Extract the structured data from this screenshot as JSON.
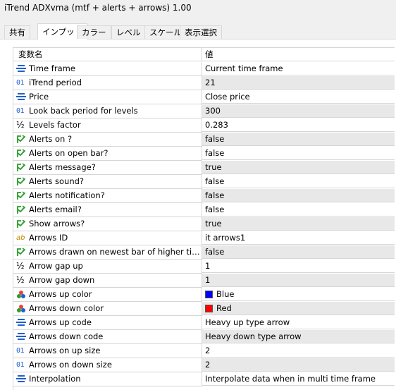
{
  "window": {
    "title": "iTrend ADXvma (mtf + alerts + arrows) 1.00"
  },
  "tabs": [
    {
      "label": "共有"
    },
    {
      "label": "インプット"
    },
    {
      "label": "カラー"
    },
    {
      "label": "レベル"
    },
    {
      "label": "スケール"
    },
    {
      "label": "表示選択"
    }
  ],
  "active_tab": "インプット",
  "grid": {
    "header": {
      "name": "変数名",
      "value": "値"
    },
    "rows": [
      {
        "icon": "enum-icon",
        "name": "Time frame",
        "value": "Current time frame"
      },
      {
        "icon": "int-icon",
        "name": "iTrend period",
        "value": "21"
      },
      {
        "icon": "enum-icon",
        "name": "Price",
        "value": "Close price"
      },
      {
        "icon": "int-icon",
        "name": "Look back period for levels",
        "value": "300"
      },
      {
        "icon": "double-icon",
        "name": "Levels factor",
        "value": "0.283"
      },
      {
        "icon": "bool-icon",
        "name": "Alerts on ?",
        "value": "false"
      },
      {
        "icon": "bool-icon",
        "name": "Alerts on open bar?",
        "value": "false"
      },
      {
        "icon": "bool-icon",
        "name": "Alerts message?",
        "value": "true"
      },
      {
        "icon": "bool-icon",
        "name": "Alerts sound?",
        "value": "false"
      },
      {
        "icon": "bool-icon",
        "name": "Alerts notification?",
        "value": "false"
      },
      {
        "icon": "bool-icon",
        "name": "Alerts email?",
        "value": "false"
      },
      {
        "icon": "bool-icon",
        "name": "Show arrows?",
        "value": "true"
      },
      {
        "icon": "string-icon",
        "name": "Arrows ID",
        "value": "it arrows1"
      },
      {
        "icon": "bool-icon",
        "name": "Arrows drawn on newest bar of higher time f...",
        "value": "false"
      },
      {
        "icon": "double-icon",
        "name": "Arrow gap up",
        "value": "1"
      },
      {
        "icon": "double-icon",
        "name": "Arrow gap down",
        "value": "1"
      },
      {
        "icon": "color-icon",
        "name": "Arrows up color",
        "value": "Blue",
        "swatch": "#0000ff"
      },
      {
        "icon": "color-icon",
        "name": "Arrows down color",
        "value": "Red",
        "swatch": "#ff0000"
      },
      {
        "icon": "enum-icon",
        "name": "Arrows up code",
        "value": "Heavy up type arrow"
      },
      {
        "icon": "enum-icon",
        "name": "Arrows down code",
        "value": "Heavy down type arrow"
      },
      {
        "icon": "int-icon",
        "name": "Arrows on up size",
        "value": "2"
      },
      {
        "icon": "int-icon",
        "name": "Arrows on down size",
        "value": "2"
      },
      {
        "icon": "enum-icon",
        "name": "Interpolation",
        "value": "Interpolate data when in multi time frame"
      }
    ]
  },
  "icon_text": {
    "int": "01",
    "string": "ab",
    "double": "½"
  },
  "colors": {
    "alt_row": "#e8e8e8",
    "grid_line": "#d6d6d6",
    "enum": "#1f5fd1",
    "bool": "#2a9d2a"
  }
}
